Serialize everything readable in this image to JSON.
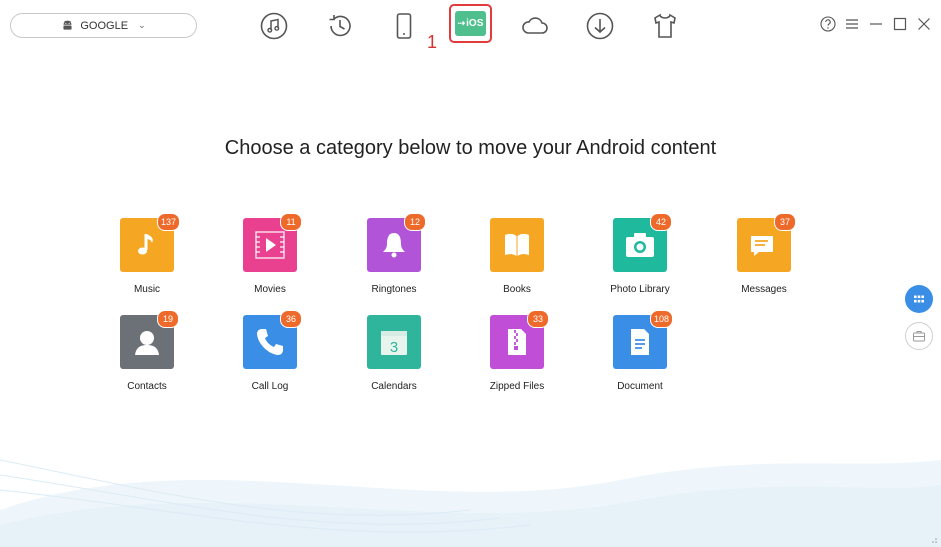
{
  "device": {
    "name": "GOOGLE"
  },
  "toolbar": {
    "items": [
      "music-manager",
      "backup-restore",
      "device-manager",
      "ios-mover",
      "cloud",
      "downloader",
      "toolkit"
    ],
    "ios_label": "iOS",
    "annotation": "1"
  },
  "heading": "Choose a category below to move your Android content",
  "categories": [
    {
      "label": "Music",
      "count": "137",
      "color": "#f5a623",
      "icon": "music-note-icon"
    },
    {
      "label": "Movies",
      "count": "11",
      "color": "#e9418f",
      "icon": "film-icon"
    },
    {
      "label": "Ringtones",
      "count": "12",
      "color": "#b254d8",
      "icon": "bell-icon"
    },
    {
      "label": "Books",
      "count": "",
      "color": "#f5a623",
      "icon": "book-icon"
    },
    {
      "label": "Photo Library",
      "count": "42",
      "color": "#1fb99e",
      "icon": "camera-icon"
    },
    {
      "label": "Messages",
      "count": "37",
      "color": "#f5a623",
      "icon": "message-icon"
    },
    {
      "label": "Contacts",
      "count": "19",
      "color": "#6b7176",
      "icon": "person-icon"
    },
    {
      "label": "Call Log",
      "count": "36",
      "color": "#3a8ee6",
      "icon": "phone-icon"
    },
    {
      "label": "Calendars",
      "count": "",
      "color": "#2fb59c",
      "icon": "calendar-icon",
      "day": "3"
    },
    {
      "label": "Zipped Files",
      "count": "33",
      "color": "#c04ed6",
      "icon": "zip-icon"
    },
    {
      "label": "Document",
      "count": "108",
      "color": "#3a8ee6",
      "icon": "document-icon"
    }
  ],
  "colors": {
    "accent": "#4fc08d",
    "highlight": "#e23b3b",
    "badge": "#ee6a2a",
    "side_active": "#3a8ee6"
  }
}
